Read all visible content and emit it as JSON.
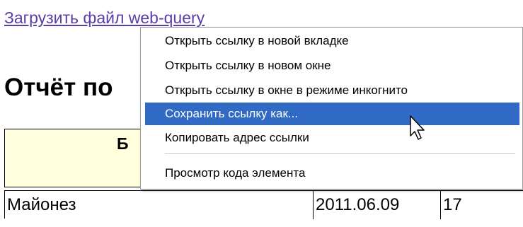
{
  "page": {
    "link_text": "Загрузить файл web-query",
    "heading": "Отчёт по",
    "table": {
      "header_first_cell": "Б",
      "rows": [
        {
          "name": "Майонез",
          "date": "2011.06.09",
          "value": "17"
        }
      ]
    }
  },
  "context_menu": {
    "items": [
      {
        "label": "Открыть ссылку в новой вкладке"
      },
      {
        "label": "Открыть ссылку в новом окне"
      },
      {
        "label": "Открыть ссылку в окне в режиме инкогнито"
      },
      {
        "label": "Сохранить ссылку как...",
        "highlighted": true
      },
      {
        "label": "Копировать адрес ссылки"
      },
      {
        "label": "Просмотр кода элемента"
      }
    ]
  },
  "colors": {
    "link": "#5a3ea6",
    "highlight": "#316ac5",
    "table_header_bg": "#ffffdd"
  },
  "icons": {
    "cursor": "mouse-pointer-icon"
  }
}
